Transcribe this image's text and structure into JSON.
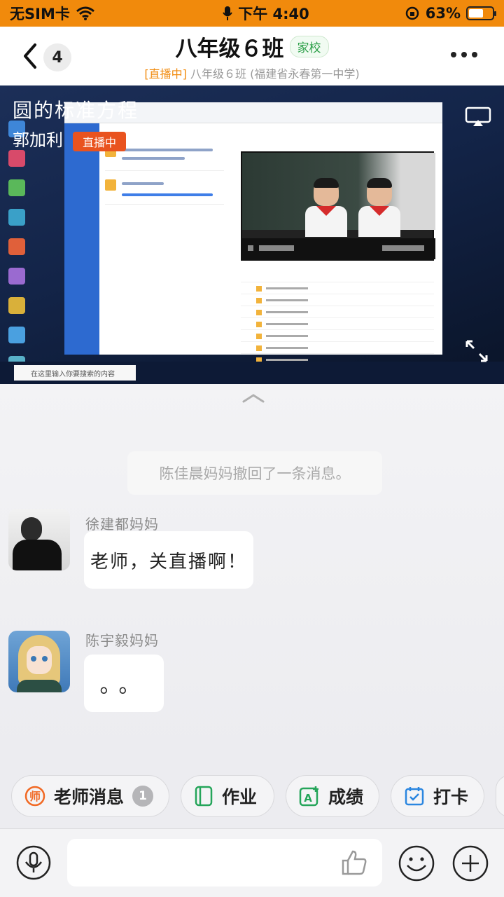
{
  "status_bar": {
    "carrier": "无SIM卡",
    "time": "下午 4:40",
    "battery_percent": "63%",
    "battery_level": 0.63
  },
  "header": {
    "unread_count": "4",
    "title": "八年级６班",
    "tag": "家校",
    "subtitle_live": "[直播中]",
    "subtitle_text": " 八年级６班 (福建省永春第一中学)"
  },
  "video": {
    "overlay_title": "圆的标准方程",
    "teacher_name": "郭加利",
    "live_badge": "直播中",
    "taskbar_search": "在这里输入你要搜索的内容"
  },
  "chat": {
    "system_message": "陈佳晨妈妈撤回了一条消息。",
    "messages": [
      {
        "sender": "徐建都妈妈",
        "text": "老师，关直播啊！"
      },
      {
        "sender": "陈宇毅妈妈",
        "text": "。。"
      }
    ]
  },
  "quick_actions": [
    {
      "label": "老师消息",
      "badge": "1",
      "icon": "teacher-icon",
      "color": "#f16a25"
    },
    {
      "label": "作业",
      "icon": "homework-icon",
      "color": "#25a55a"
    },
    {
      "label": "成绩",
      "icon": "grades-icon",
      "color": "#25a55a"
    },
    {
      "label": "打卡",
      "icon": "checkin-icon",
      "color": "#2a86e0"
    }
  ],
  "colors": {
    "status_bar": "#f18a0c",
    "accent_orange": "#f18a0c",
    "tag_green": "#2ea04a"
  }
}
